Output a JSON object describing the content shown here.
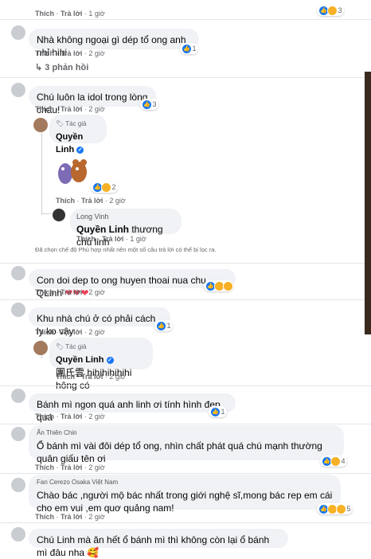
{
  "actions": {
    "like": "Thích",
    "reply": "Trả lời"
  },
  "comments": [
    {
      "time": "1 giờ",
      "reactions": "3"
    },
    {
      "text": "Nhà không ngoại gì dép tổ ong anh nhỉ hihi",
      "time": "2 giờ",
      "reactions": "1",
      "replies": "3 phản hồi"
    },
    {
      "text": "Chú luôn la idol trong lòng cháu!",
      "time": "2 giờ",
      "reactions": "3"
    },
    {
      "author_tag": "Tác giả",
      "name": "Quyền Linh",
      "time": "2 giờ",
      "reactions": "2"
    },
    {
      "name": "Long Vinh",
      "mention": "Quyền Linh",
      "text": "thương chú linh",
      "time": "1 giờ"
    },
    {
      "text": "Con doi dep to ong huyen thoai nua chu QLinh",
      "time": "2 giờ"
    },
    {
      "text": "Khu nhà chú ở có phải cách ly ko vậy",
      "time": "2 giờ",
      "reactions": "1"
    },
    {
      "author_tag": "Tác giả",
      "name": "Quyền Linh",
      "text": "團氏雲 hihihihihihi hông có",
      "time": "2 giờ"
    },
    {
      "text": "Bánh mì ngon quá anh linh ơi tính hình đẹp quá",
      "time": "2 giờ",
      "reactions": "1"
    },
    {
      "name": "Ấn Thiên Chin",
      "text": "Ổ bánh mì vài đôi dép tổ ong, nhìn chất phát quá chú mạnh thường quân giấu tên ơi",
      "time": "2 giờ",
      "reactions": "4"
    },
    {
      "name": "Fan Cerezo Osaka Việt Nam",
      "text": "Chào bác ,người mộ bác nhất trong giới nghệ sĩ,mong bác rep em cái cho em vui ,em quơ quảng nam!",
      "time": "2 giờ",
      "reactions": "5"
    },
    {
      "text": "Chú Linh mà ăn hết ổ bánh mì thì không còn lại ổ bánh mì đâu nha"
    }
  ],
  "filter_notice": "Đã chọn chế độ Phù hợp nhất nên một số câu trả lời có thể bị lọc ra.",
  "colors": {
    "bubble": "#f0f2f5",
    "meta": "#65676b",
    "like": "#1877f2",
    "love": "#f33e58"
  }
}
